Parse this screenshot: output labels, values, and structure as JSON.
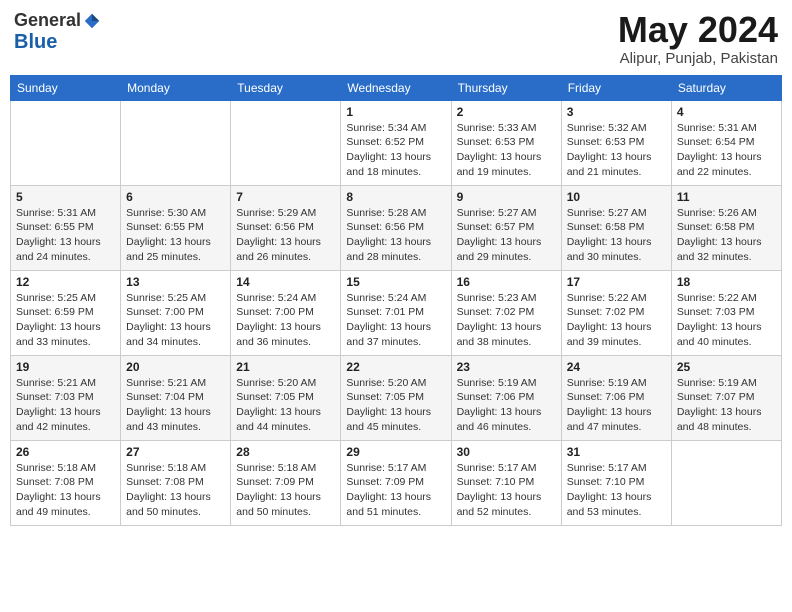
{
  "logo": {
    "general": "General",
    "blue": "Blue"
  },
  "title": "May 2024",
  "location": "Alipur, Punjab, Pakistan",
  "days_of_week": [
    "Sunday",
    "Monday",
    "Tuesday",
    "Wednesday",
    "Thursday",
    "Friday",
    "Saturday"
  ],
  "weeks": [
    [
      {
        "day": "",
        "info": ""
      },
      {
        "day": "",
        "info": ""
      },
      {
        "day": "",
        "info": ""
      },
      {
        "day": "1",
        "info": "Sunrise: 5:34 AM\nSunset: 6:52 PM\nDaylight: 13 hours\nand 18 minutes."
      },
      {
        "day": "2",
        "info": "Sunrise: 5:33 AM\nSunset: 6:53 PM\nDaylight: 13 hours\nand 19 minutes."
      },
      {
        "day": "3",
        "info": "Sunrise: 5:32 AM\nSunset: 6:53 PM\nDaylight: 13 hours\nand 21 minutes."
      },
      {
        "day": "4",
        "info": "Sunrise: 5:31 AM\nSunset: 6:54 PM\nDaylight: 13 hours\nand 22 minutes."
      }
    ],
    [
      {
        "day": "5",
        "info": "Sunrise: 5:31 AM\nSunset: 6:55 PM\nDaylight: 13 hours\nand 24 minutes."
      },
      {
        "day": "6",
        "info": "Sunrise: 5:30 AM\nSunset: 6:55 PM\nDaylight: 13 hours\nand 25 minutes."
      },
      {
        "day": "7",
        "info": "Sunrise: 5:29 AM\nSunset: 6:56 PM\nDaylight: 13 hours\nand 26 minutes."
      },
      {
        "day": "8",
        "info": "Sunrise: 5:28 AM\nSunset: 6:56 PM\nDaylight: 13 hours\nand 28 minutes."
      },
      {
        "day": "9",
        "info": "Sunrise: 5:27 AM\nSunset: 6:57 PM\nDaylight: 13 hours\nand 29 minutes."
      },
      {
        "day": "10",
        "info": "Sunrise: 5:27 AM\nSunset: 6:58 PM\nDaylight: 13 hours\nand 30 minutes."
      },
      {
        "day": "11",
        "info": "Sunrise: 5:26 AM\nSunset: 6:58 PM\nDaylight: 13 hours\nand 32 minutes."
      }
    ],
    [
      {
        "day": "12",
        "info": "Sunrise: 5:25 AM\nSunset: 6:59 PM\nDaylight: 13 hours\nand 33 minutes."
      },
      {
        "day": "13",
        "info": "Sunrise: 5:25 AM\nSunset: 7:00 PM\nDaylight: 13 hours\nand 34 minutes."
      },
      {
        "day": "14",
        "info": "Sunrise: 5:24 AM\nSunset: 7:00 PM\nDaylight: 13 hours\nand 36 minutes."
      },
      {
        "day": "15",
        "info": "Sunrise: 5:24 AM\nSunset: 7:01 PM\nDaylight: 13 hours\nand 37 minutes."
      },
      {
        "day": "16",
        "info": "Sunrise: 5:23 AM\nSunset: 7:02 PM\nDaylight: 13 hours\nand 38 minutes."
      },
      {
        "day": "17",
        "info": "Sunrise: 5:22 AM\nSunset: 7:02 PM\nDaylight: 13 hours\nand 39 minutes."
      },
      {
        "day": "18",
        "info": "Sunrise: 5:22 AM\nSunset: 7:03 PM\nDaylight: 13 hours\nand 40 minutes."
      }
    ],
    [
      {
        "day": "19",
        "info": "Sunrise: 5:21 AM\nSunset: 7:03 PM\nDaylight: 13 hours\nand 42 minutes."
      },
      {
        "day": "20",
        "info": "Sunrise: 5:21 AM\nSunset: 7:04 PM\nDaylight: 13 hours\nand 43 minutes."
      },
      {
        "day": "21",
        "info": "Sunrise: 5:20 AM\nSunset: 7:05 PM\nDaylight: 13 hours\nand 44 minutes."
      },
      {
        "day": "22",
        "info": "Sunrise: 5:20 AM\nSunset: 7:05 PM\nDaylight: 13 hours\nand 45 minutes."
      },
      {
        "day": "23",
        "info": "Sunrise: 5:19 AM\nSunset: 7:06 PM\nDaylight: 13 hours\nand 46 minutes."
      },
      {
        "day": "24",
        "info": "Sunrise: 5:19 AM\nSunset: 7:06 PM\nDaylight: 13 hours\nand 47 minutes."
      },
      {
        "day": "25",
        "info": "Sunrise: 5:19 AM\nSunset: 7:07 PM\nDaylight: 13 hours\nand 48 minutes."
      }
    ],
    [
      {
        "day": "26",
        "info": "Sunrise: 5:18 AM\nSunset: 7:08 PM\nDaylight: 13 hours\nand 49 minutes."
      },
      {
        "day": "27",
        "info": "Sunrise: 5:18 AM\nSunset: 7:08 PM\nDaylight: 13 hours\nand 50 minutes."
      },
      {
        "day": "28",
        "info": "Sunrise: 5:18 AM\nSunset: 7:09 PM\nDaylight: 13 hours\nand 50 minutes."
      },
      {
        "day": "29",
        "info": "Sunrise: 5:17 AM\nSunset: 7:09 PM\nDaylight: 13 hours\nand 51 minutes."
      },
      {
        "day": "30",
        "info": "Sunrise: 5:17 AM\nSunset: 7:10 PM\nDaylight: 13 hours\nand 52 minutes."
      },
      {
        "day": "31",
        "info": "Sunrise: 5:17 AM\nSunset: 7:10 PM\nDaylight: 13 hours\nand 53 minutes."
      },
      {
        "day": "",
        "info": ""
      }
    ]
  ]
}
